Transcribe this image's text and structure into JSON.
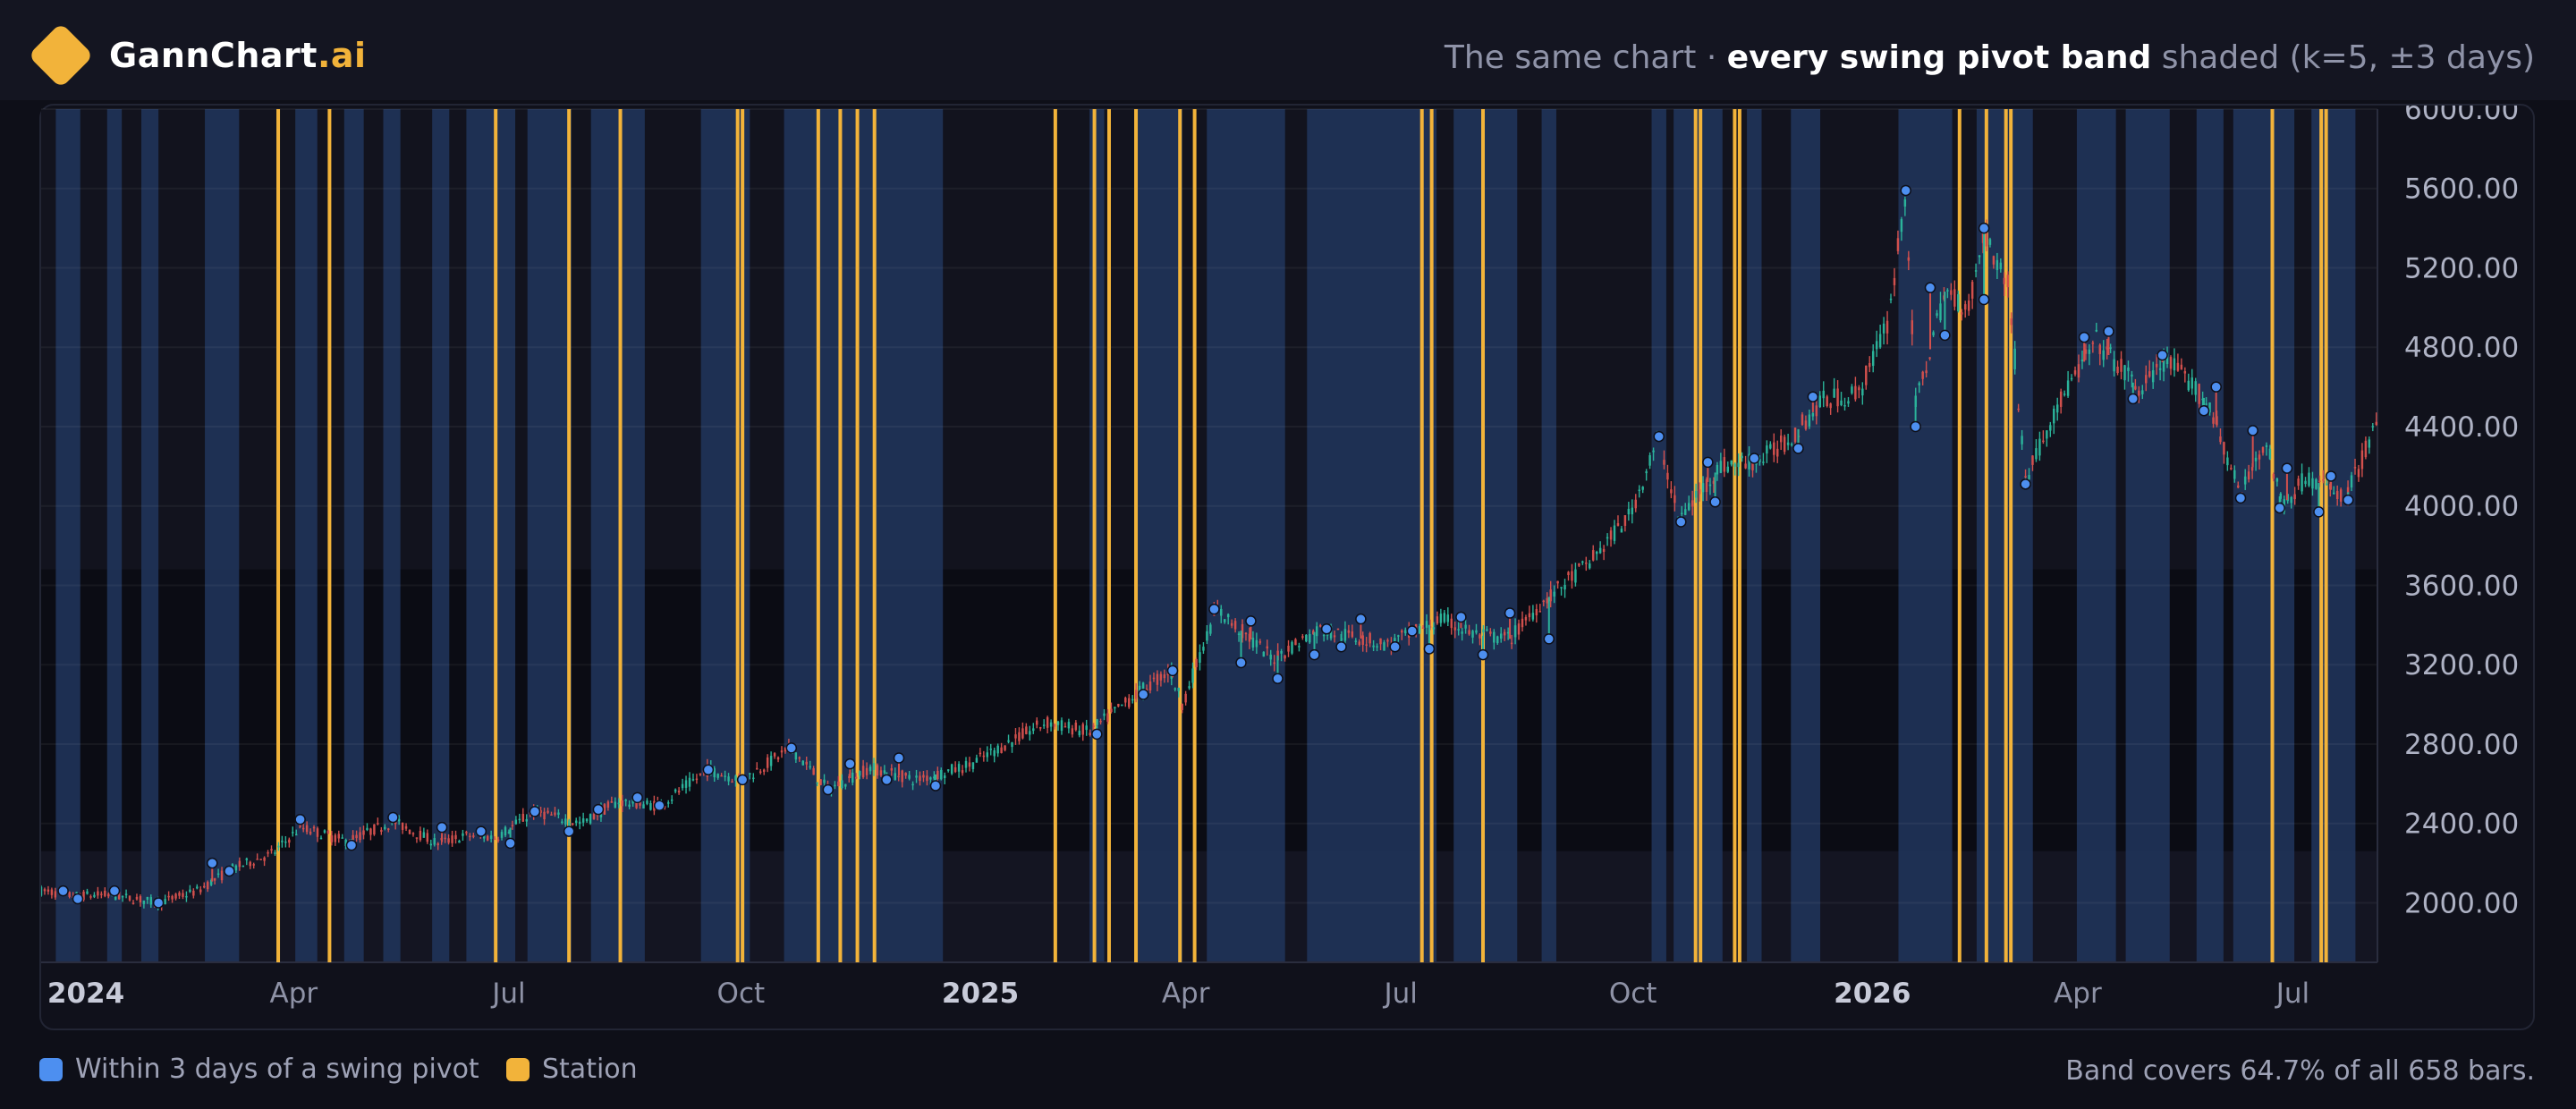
{
  "header": {
    "brand_main": "GannChart",
    "brand_suffix": ".ai",
    "subtitle_prefix": "The same chart · ",
    "subtitle_strong": "every swing pivot band",
    "subtitle_suffix": " shaded (k=5, ±3 days)"
  },
  "legend": {
    "items": [
      {
        "label": "Within 3 days of a swing pivot",
        "color": "#4d8ff0"
      },
      {
        "label": "Station",
        "color": "#f2b33a"
      }
    ]
  },
  "footer": {
    "note": "Band covers 64.7% of all 658 bars."
  },
  "colors": {
    "band": "#1f3358",
    "station": "#f2b33a",
    "up": "#2bb39a",
    "down": "#d2504d",
    "pivot": "#4d8ff0"
  },
  "chart_data": {
    "type": "candlestick",
    "x_range": [
      "2023-12-28",
      "2026-08-10"
    ],
    "ylim": [
      1700,
      6000
    ],
    "yticks": [
      "2000.00",
      "2400.00",
      "2800.00",
      "3200.00",
      "3600.00",
      "4000.00",
      "4400.00",
      "4800.00",
      "5200.00",
      "5600.00",
      "6000.00"
    ],
    "xticks": [
      {
        "date": "2024-01-01",
        "label": "2024",
        "bold": true
      },
      {
        "date": "2024-04-01",
        "label": "Apr",
        "bold": false
      },
      {
        "date": "2024-07-01",
        "label": "Jul",
        "bold": false
      },
      {
        "date": "2024-10-01",
        "label": "Oct",
        "bold": false
      },
      {
        "date": "2025-01-01",
        "label": "2025",
        "bold": true
      },
      {
        "date": "2025-04-01",
        "label": "Apr",
        "bold": false
      },
      {
        "date": "2025-07-01",
        "label": "Jul",
        "bold": false
      },
      {
        "date": "2025-10-01",
        "label": "Oct",
        "bold": false
      },
      {
        "date": "2026-01-01",
        "label": "2026",
        "bold": true
      },
      {
        "date": "2026-04-01",
        "label": "Apr",
        "bold": false
      },
      {
        "date": "2026-07-01",
        "label": "Jul",
        "bold": false
      }
    ],
    "price_path": [
      [
        "2023-12-28",
        2060
      ],
      [
        "2024-01-10",
        2035
      ],
      [
        "2024-01-25",
        2040
      ],
      [
        "2024-02-14",
        2000
      ],
      [
        "2024-03-01",
        2060
      ],
      [
        "2024-03-15",
        2170
      ],
      [
        "2024-04-01",
        2250
      ],
      [
        "2024-04-12",
        2380
      ],
      [
        "2024-05-01",
        2310
      ],
      [
        "2024-05-20",
        2410
      ],
      [
        "2024-06-07",
        2300
      ],
      [
        "2024-06-20",
        2340
      ],
      [
        "2024-07-01",
        2330
      ],
      [
        "2024-07-17",
        2460
      ],
      [
        "2024-08-05",
        2400
      ],
      [
        "2024-08-20",
        2510
      ],
      [
        "2024-09-06",
        2490
      ],
      [
        "2024-09-26",
        2670
      ],
      [
        "2024-10-10",
        2620
      ],
      [
        "2024-10-30",
        2780
      ],
      [
        "2024-11-14",
        2570
      ],
      [
        "2024-12-01",
        2680
      ],
      [
        "2024-12-20",
        2620
      ],
      [
        "2025-01-10",
        2690
      ],
      [
        "2025-02-11",
        2910
      ],
      [
        "2025-03-01",
        2860
      ],
      [
        "2025-03-20",
        3050
      ],
      [
        "2025-04-03",
        3170
      ],
      [
        "2025-04-08",
        3000
      ],
      [
        "2025-04-22",
        3480
      ],
      [
        "2025-05-15",
        3230
      ],
      [
        "2025-06-03",
        3380
      ],
      [
        "2025-07-01",
        3300
      ],
      [
        "2025-07-23",
        3430
      ],
      [
        "2025-08-06",
        3350
      ],
      [
        "2025-08-20",
        3330
      ],
      [
        "2025-09-01",
        3500
      ],
      [
        "2025-09-22",
        3720
      ],
      [
        "2025-10-08",
        3950
      ],
      [
        "2025-10-20",
        4350
      ],
      [
        "2025-10-28",
        3930
      ],
      [
        "2025-11-14",
        4200
      ],
      [
        "2025-11-30",
        4230
      ],
      [
        "2025-12-12",
        4330
      ],
      [
        "2025-12-26",
        4530
      ],
      [
        "2026-01-10",
        4570
      ],
      [
        "2026-01-22",
        4940
      ],
      [
        "2026-01-29",
        5590
      ],
      [
        "2026-02-02",
        4500
      ],
      [
        "2026-02-14",
        5080
      ],
      [
        "2026-02-24",
        5000
      ],
      [
        "2026-03-02",
        5380
      ],
      [
        "2026-03-12",
        5100
      ],
      [
        "2026-03-19",
        4140
      ],
      [
        "2026-04-01",
        4500
      ],
      [
        "2026-04-17",
        4830
      ],
      [
        "2026-05-05",
        4580
      ],
      [
        "2026-05-15",
        4740
      ],
      [
        "2026-06-02",
        4520
      ],
      [
        "2026-06-15",
        4050
      ],
      [
        "2026-06-25",
        4340
      ],
      [
        "2026-07-02",
        4000
      ],
      [
        "2026-07-12",
        4150
      ],
      [
        "2026-07-28",
        4040
      ],
      [
        "2026-08-10",
        4420
      ]
    ],
    "pivots": [
      [
        "2024-01-06",
        2060,
        "high"
      ],
      [
        "2024-01-12",
        2020,
        "low"
      ],
      [
        "2024-01-27",
        2060,
        "high"
      ],
      [
        "2024-02-14",
        2000,
        "low"
      ],
      [
        "2024-03-07",
        2200,
        "high"
      ],
      [
        "2024-03-14",
        2160,
        "low"
      ],
      [
        "2024-04-12",
        2420,
        "high"
      ],
      [
        "2024-05-03",
        2290,
        "low"
      ],
      [
        "2024-05-20",
        2430,
        "high"
      ],
      [
        "2024-06-09",
        2380,
        "high"
      ],
      [
        "2024-06-25",
        2360,
        "high"
      ],
      [
        "2024-07-07",
        2300,
        "low"
      ],
      [
        "2024-07-17",
        2460,
        "high"
      ],
      [
        "2024-07-31",
        2360,
        "low"
      ],
      [
        "2024-08-12",
        2470,
        "high"
      ],
      [
        "2024-08-28",
        2530,
        "high"
      ],
      [
        "2024-09-06",
        2490,
        "low"
      ],
      [
        "2024-09-26",
        2670,
        "high"
      ],
      [
        "2024-10-10",
        2620,
        "low"
      ],
      [
        "2024-10-30",
        2780,
        "high"
      ],
      [
        "2024-11-14",
        2570,
        "low"
      ],
      [
        "2024-11-23",
        2700,
        "high"
      ],
      [
        "2024-12-08",
        2620,
        "low"
      ],
      [
        "2024-12-13",
        2730,
        "high"
      ],
      [
        "2024-12-28",
        2590,
        "low"
      ],
      [
        "2025-03-04",
        2850,
        "low"
      ],
      [
        "2025-03-23",
        3050,
        "high"
      ],
      [
        "2025-04-04",
        3170,
        "high"
      ],
      [
        "2025-04-21",
        3480,
        "high"
      ],
      [
        "2025-05-02",
        3210,
        "low"
      ],
      [
        "2025-05-06",
        3420,
        "high"
      ],
      [
        "2025-05-17",
        3130,
        "low"
      ],
      [
        "2025-06-01",
        3250,
        "low"
      ],
      [
        "2025-06-06",
        3380,
        "high"
      ],
      [
        "2025-06-12",
        3290,
        "low"
      ],
      [
        "2025-06-20",
        3430,
        "high"
      ],
      [
        "2025-07-04",
        3290,
        "low"
      ],
      [
        "2025-07-11",
        3370,
        "high"
      ],
      [
        "2025-07-18",
        3280,
        "low"
      ],
      [
        "2025-07-31",
        3440,
        "high"
      ],
      [
        "2025-08-09",
        3250,
        "low"
      ],
      [
        "2025-08-20",
        3460,
        "high"
      ],
      [
        "2025-09-05",
        3330,
        "low"
      ],
      [
        "2025-10-20",
        4350,
        "high"
      ],
      [
        "2025-10-29",
        3920,
        "low"
      ],
      [
        "2025-11-09",
        4220,
        "high"
      ],
      [
        "2025-11-12",
        4020,
        "low"
      ],
      [
        "2025-11-28",
        4240,
        "high"
      ],
      [
        "2025-12-16",
        4290,
        "low"
      ],
      [
        "2025-12-22",
        4550,
        "high"
      ],
      [
        "2026-01-29",
        5590,
        "high"
      ],
      [
        "2026-02-02",
        4400,
        "low"
      ],
      [
        "2026-02-08",
        5100,
        "high"
      ],
      [
        "2026-02-14",
        4860,
        "low"
      ],
      [
        "2026-03-02",
        5400,
        "high"
      ],
      [
        "2026-03-02",
        5040,
        "low"
      ],
      [
        "2026-03-19",
        4110,
        "low"
      ],
      [
        "2026-04-12",
        4850,
        "high"
      ],
      [
        "2026-04-22",
        4880,
        "high"
      ],
      [
        "2026-05-02",
        4540,
        "low"
      ],
      [
        "2026-05-14",
        4760,
        "high"
      ],
      [
        "2026-05-31",
        4480,
        "low"
      ],
      [
        "2026-06-05",
        4600,
        "high"
      ],
      [
        "2026-06-15",
        4040,
        "low"
      ],
      [
        "2026-06-20",
        4380,
        "high"
      ],
      [
        "2026-07-01",
        3990,
        "low"
      ],
      [
        "2026-07-04",
        4190,
        "high"
      ],
      [
        "2026-07-17",
        3970,
        "low"
      ],
      [
        "2026-07-22",
        4150,
        "high"
      ],
      [
        "2026-07-29",
        4030,
        "low"
      ]
    ],
    "bands": [
      [
        "2024-01-03",
        "2024-01-13"
      ],
      [
        "2024-01-24",
        "2024-01-30"
      ],
      [
        "2024-02-07",
        "2024-02-14"
      ],
      [
        "2024-03-04",
        "2024-03-18"
      ],
      [
        "2024-04-10",
        "2024-04-19"
      ],
      [
        "2024-04-30",
        "2024-05-08"
      ],
      [
        "2024-05-16",
        "2024-05-23"
      ],
      [
        "2024-06-05",
        "2024-06-12"
      ],
      [
        "2024-06-19",
        "2024-07-09"
      ],
      [
        "2024-07-14",
        "2024-08-01"
      ],
      [
        "2024-08-09",
        "2024-08-31"
      ],
      [
        "2024-09-23",
        "2024-10-13"
      ],
      [
        "2024-10-27",
        "2024-12-31"
      ],
      [
        "2025-03-01",
        "2025-03-07"
      ],
      [
        "2025-03-20",
        "2025-04-08"
      ],
      [
        "2025-04-18",
        "2025-05-20"
      ],
      [
        "2025-05-29",
        "2025-07-21"
      ],
      [
        "2025-07-28",
        "2025-08-23"
      ],
      [
        "2025-09-02",
        "2025-09-08"
      ],
      [
        "2025-10-17",
        "2025-10-23"
      ],
      [
        "2025-10-26",
        "2025-11-15"
      ],
      [
        "2025-11-25",
        "2025-12-01"
      ],
      [
        "2025-12-13",
        "2025-12-25"
      ],
      [
        "2026-01-26",
        "2026-02-17"
      ],
      [
        "2026-02-27",
        "2026-03-22"
      ],
      [
        "2026-04-09",
        "2026-04-25"
      ],
      [
        "2026-04-29",
        "2026-05-17"
      ],
      [
        "2026-05-28",
        "2026-06-08"
      ],
      [
        "2026-06-12",
        "2026-07-07"
      ],
      [
        "2026-07-14",
        "2026-08-01"
      ]
    ],
    "stations": [
      "2024-04-03",
      "2024-04-24",
      "2024-07-01",
      "2024-07-31",
      "2024-08-21",
      "2024-10-08",
      "2024-10-10",
      "2024-11-10",
      "2024-11-19",
      "2024-11-26",
      "2024-12-03",
      "2025-02-15",
      "2025-03-03",
      "2025-03-09",
      "2025-03-20",
      "2025-04-07",
      "2025-04-13",
      "2025-07-15",
      "2025-07-19",
      "2025-08-09",
      "2025-11-04",
      "2025-11-06",
      "2025-11-20",
      "2025-11-22",
      "2026-02-20",
      "2026-03-03",
      "2026-03-11",
      "2026-03-13",
      "2026-06-28",
      "2026-07-18",
      "2026-07-20"
    ]
  }
}
